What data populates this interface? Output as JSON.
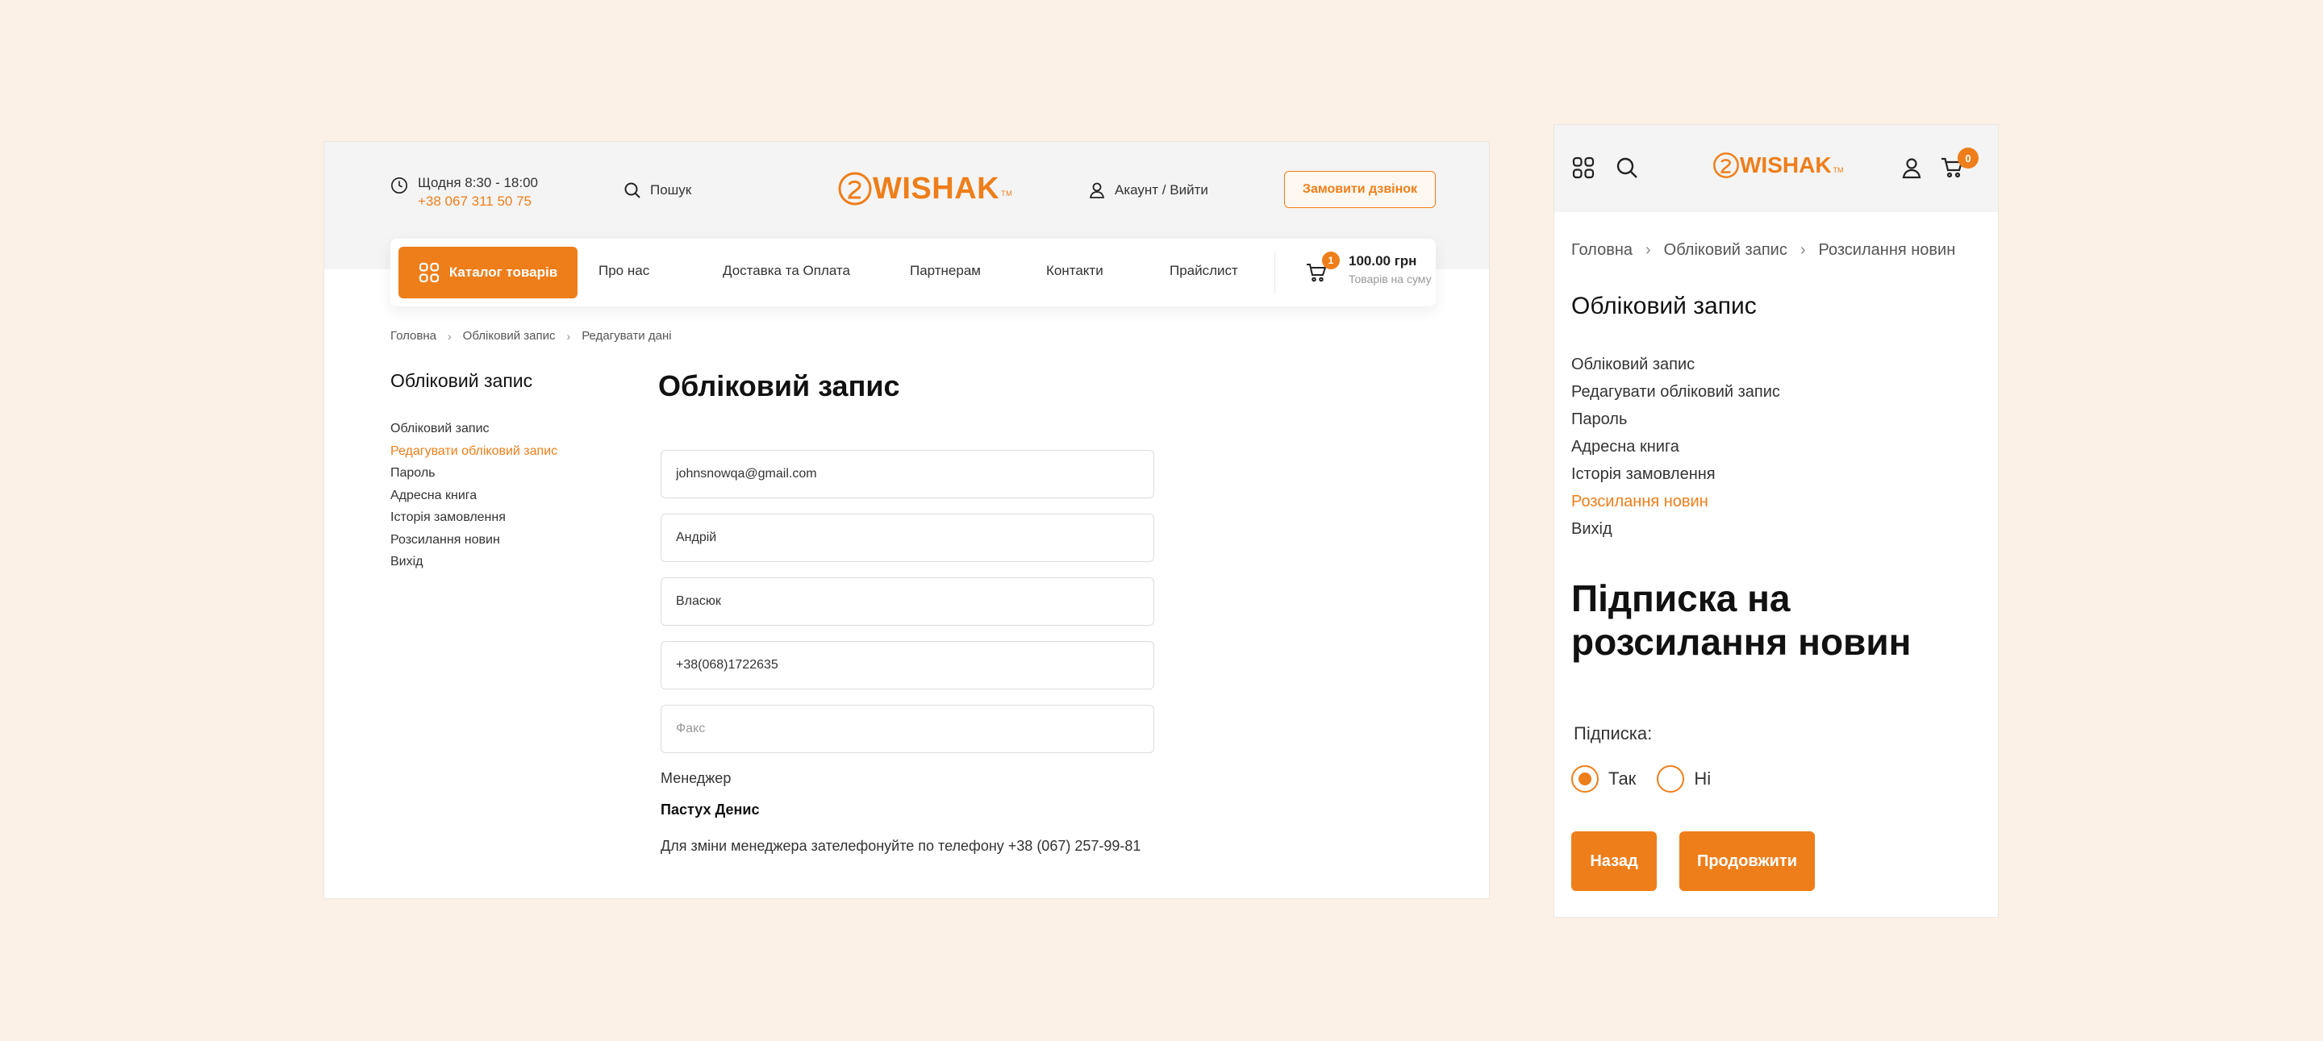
{
  "brand": {
    "name": "WISHAK",
    "tm": "TM",
    "accent": "#ee7e1a"
  },
  "desktop": {
    "header": {
      "hours": "Щодня 8:30 - 18:00",
      "phone": "+38 067 311 50 75",
      "search": "Пошук",
      "account": "Акаунт / Вийти",
      "callback": "Замовити дзвінок"
    },
    "nav": {
      "catalog": "Каталог товарів",
      "links": [
        "Про нас",
        "Доставка та Оплата",
        "Партнерам",
        "Контакти",
        "Прайслист"
      ],
      "cart_count": "1",
      "cart_total": "100.00 грн",
      "cart_sub": "Товарів на суму"
    },
    "breadcrumbs": [
      "Головна",
      "Обліковий запис",
      "Редагувати дані"
    ],
    "sidebar": {
      "title": "Обліковий запис",
      "items": [
        "Обліковий запис",
        "Редагувати обліковий запис",
        "Пароль",
        "Адресна книга",
        "Історія замовлення",
        "Розсилання новин",
        "Вихід"
      ],
      "active_index": 1
    },
    "main": {
      "title": "Обліковий запис",
      "fields": {
        "email": "johnsnowqa@gmail.com",
        "first_name": "Андрій",
        "last_name": "Власюк",
        "phone": "+38(068)1722635",
        "fax_placeholder": "Факс"
      },
      "manager_label": "Менеджер",
      "manager_name": "Пастух Денис",
      "manager_note": "Для зміни менеджера зателефонуйте по телефону +38 (067) 257-99-81"
    }
  },
  "mobile": {
    "header": {
      "cart_count": "0"
    },
    "breadcrumbs": [
      "Головна",
      "Обліковий запис",
      "Розсилання новин"
    ],
    "sidebar": {
      "title": "Обліковий запис",
      "items": [
        "Обліковий запис",
        "Редагувати обліковий запис",
        "Пароль",
        "Адресна книга",
        "Історія замовлення",
        "Розсилання новин",
        "Вихід"
      ],
      "active_index": 5
    },
    "main": {
      "title": "Підписка на розсилання новин",
      "subscription_label": "Підписка:",
      "options": [
        "Так",
        "Ні"
      ],
      "selected": "Так",
      "back": "Назад",
      "continue": "Продовжити"
    }
  }
}
